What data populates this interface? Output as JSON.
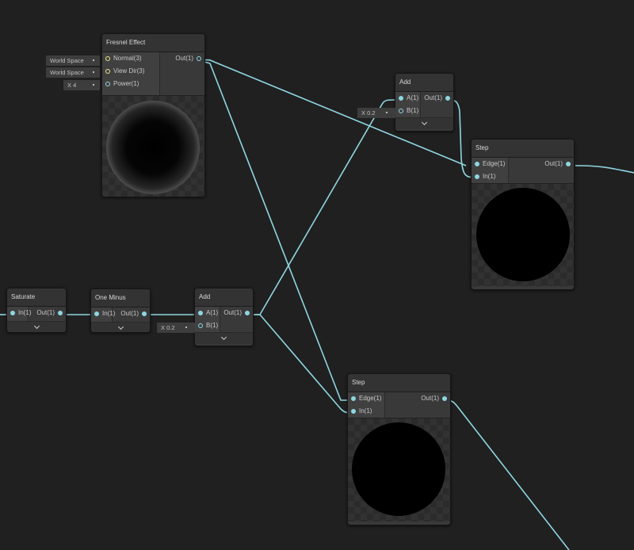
{
  "colors": {
    "background": "#202020",
    "wire": "#8fd6e0",
    "node": "#393939"
  },
  "nodes": {
    "fresnel": {
      "title": "Fresnel Effect",
      "inputs": [
        "Normal(3)",
        "View Dir(3)",
        "Power(1)"
      ],
      "outputs": [
        "Out(1)"
      ],
      "constants": [
        "World Space",
        "World Space",
        "X  4"
      ]
    },
    "add_top": {
      "title": "Add",
      "inputs": [
        "A(1)",
        "B(1)"
      ],
      "outputs": [
        "Out(1)"
      ],
      "constants": [
        "X  0.2"
      ]
    },
    "step_top": {
      "title": "Step",
      "inputs": [
        "Edge(1)",
        "In(1)"
      ],
      "outputs": [
        "Out(1)"
      ]
    },
    "saturate": {
      "title": "Saturate",
      "inputs": [
        "In(1)"
      ],
      "outputs": [
        "Out(1)"
      ]
    },
    "one_minus": {
      "title": "One Minus",
      "inputs": [
        "In(1)"
      ],
      "outputs": [
        "Out(1)"
      ]
    },
    "add_mid": {
      "title": "Add",
      "inputs": [
        "A(1)",
        "B(1)"
      ],
      "outputs": [
        "Out(1)"
      ],
      "constants": [
        "X  0.2"
      ]
    },
    "step_bottom": {
      "title": "Step",
      "inputs": [
        "Edge(1)",
        "In(1)"
      ],
      "outputs": [
        "Out(1)"
      ]
    }
  }
}
